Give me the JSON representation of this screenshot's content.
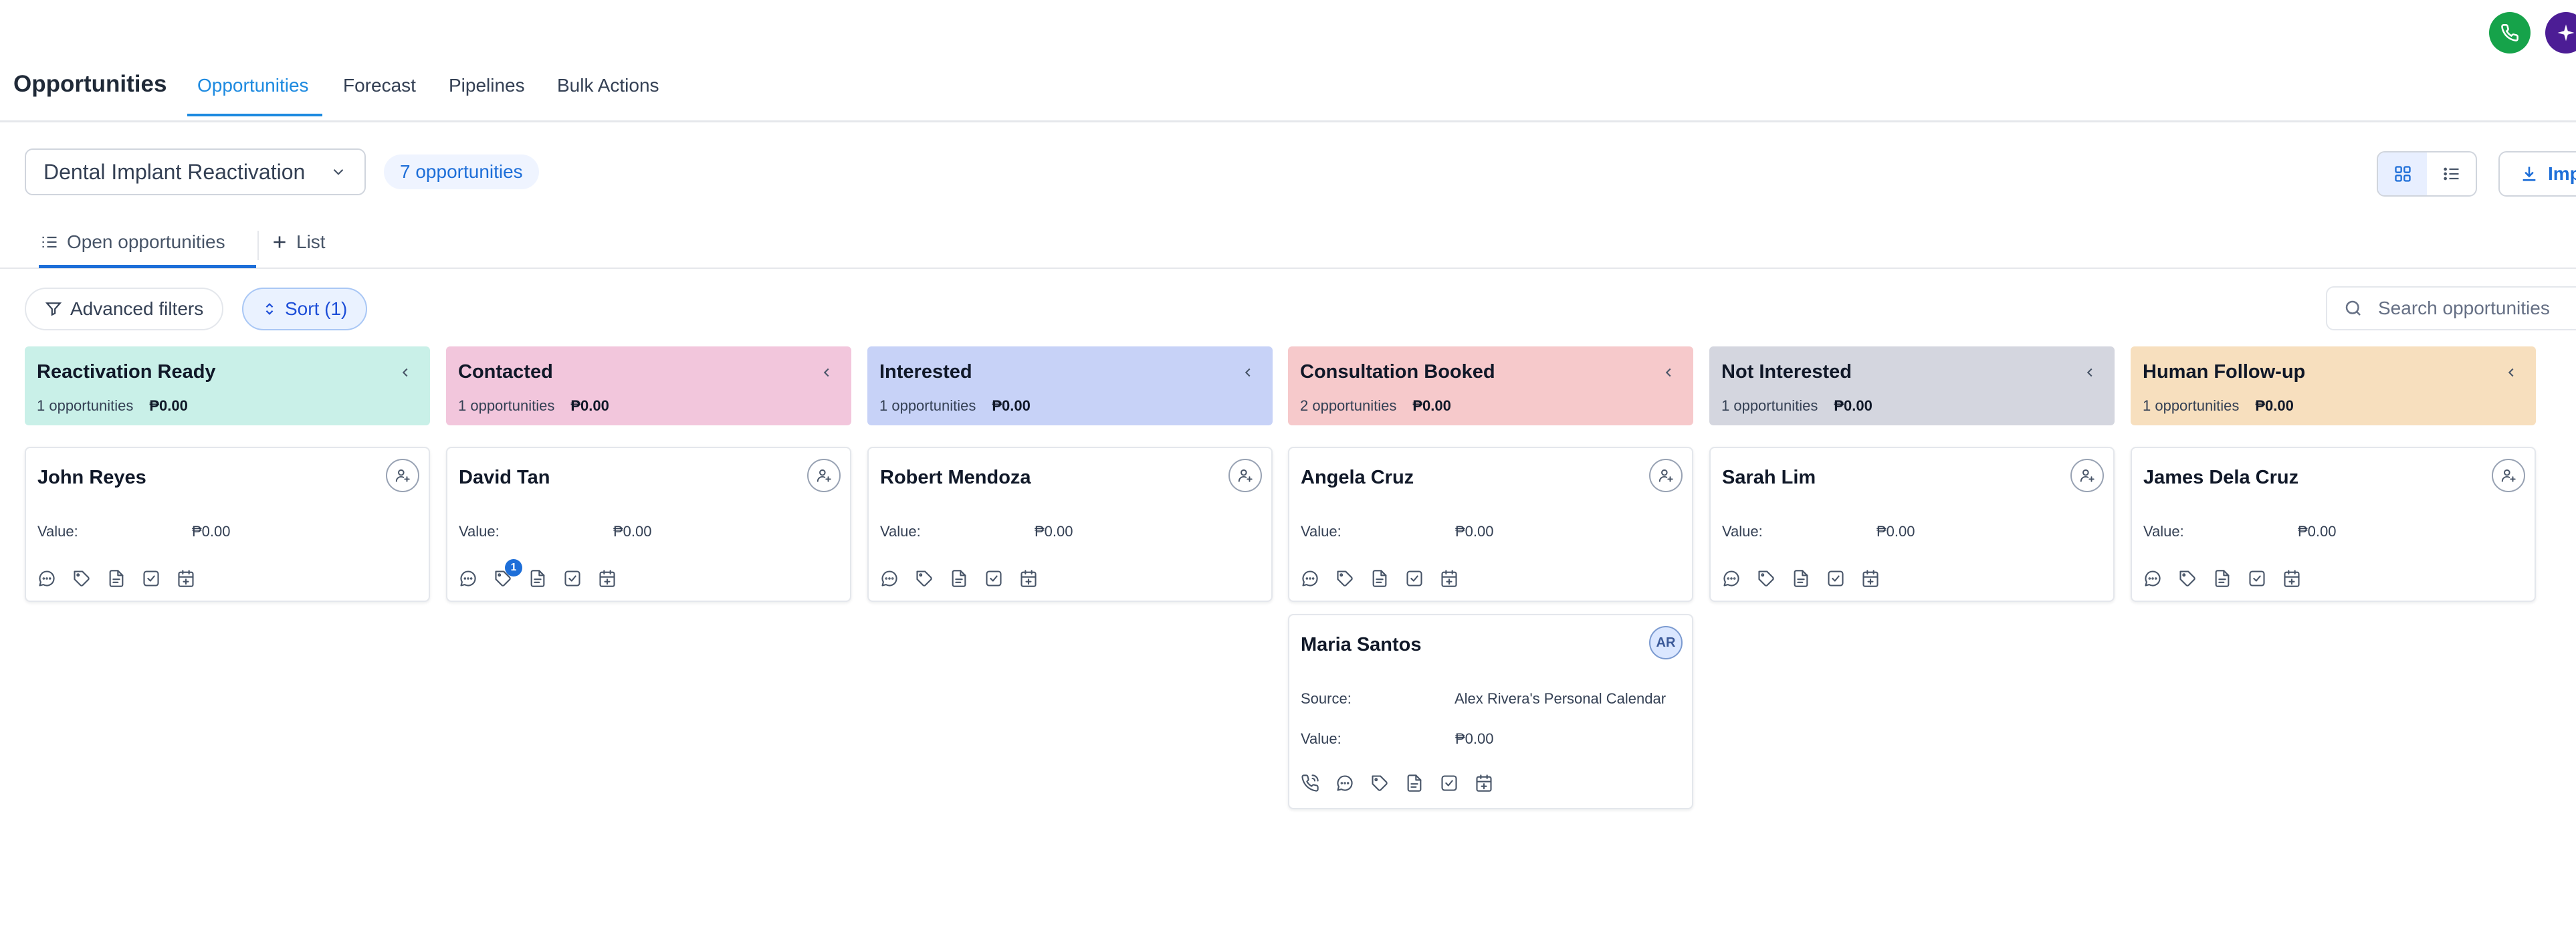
{
  "header": {
    "page_title": "Opportunities",
    "tabs": [
      {
        "label": "Opportunities",
        "active": true
      },
      {
        "label": "Forecast"
      },
      {
        "label": "Pipelines"
      },
      {
        "label": "Bulk Actions"
      }
    ]
  },
  "toolbar": {
    "pipeline": "Dental Implant Reactivation",
    "count_label": "7 opportunities",
    "import_label": "Imp"
  },
  "subtabs": [
    {
      "label": "Open opportunities",
      "icon": "list-icon",
      "active": true
    },
    {
      "label": "List",
      "icon": "plus-icon"
    }
  ],
  "filters": {
    "advanced_label": "Advanced filters",
    "sort_label": "Sort (1)",
    "search_placeholder": "Search opportunities"
  },
  "columns": [
    {
      "title": "Reactivation Ready",
      "count": "1 opportunities",
      "amount": "₱0.00",
      "color": "#c9f0e8"
    },
    {
      "title": "Contacted",
      "count": "1 opportunities",
      "amount": "₱0.00",
      "color": "#f2c6dc"
    },
    {
      "title": "Interested",
      "count": "1 opportunities",
      "amount": "₱0.00",
      "color": "#c7d2f7"
    },
    {
      "title": "Consultation Booked",
      "count": "2 opportunities",
      "amount": "₱0.00",
      "color": "#f6c9cb"
    },
    {
      "title": "Not Interested",
      "count": "1 opportunities",
      "amount": "₱0.00",
      "color": "#d4d6df"
    },
    {
      "title": "Human Follow-up",
      "count": "1 opportunities",
      "amount": "₱0.00",
      "color": "#f7dfbe"
    }
  ],
  "cards": {
    "c0": {
      "name": "John Reyes",
      "value_label": "Value:",
      "value": "₱0.00"
    },
    "c1": {
      "name": "David Tan",
      "value_label": "Value:",
      "value": "₱0.00",
      "tag_badge": "1"
    },
    "c2": {
      "name": "Robert Mendoza",
      "value_label": "Value:",
      "value": "₱0.00"
    },
    "c3": {
      "name": "Angela Cruz",
      "value_label": "Value:",
      "value": "₱0.00"
    },
    "c4": {
      "name": "Sarah Lim",
      "value_label": "Value:",
      "value": "₱0.00"
    },
    "c5": {
      "name": "James Dela Cruz",
      "value_label": "Value:",
      "value": "₱0.00"
    },
    "c6": {
      "name": "Maria Santos",
      "assignee_initials": "AR",
      "source_label": "Source:",
      "source": "Alex Rivera's Personal Calendar",
      "value_label": "Value:",
      "value": "₱0.00"
    }
  }
}
